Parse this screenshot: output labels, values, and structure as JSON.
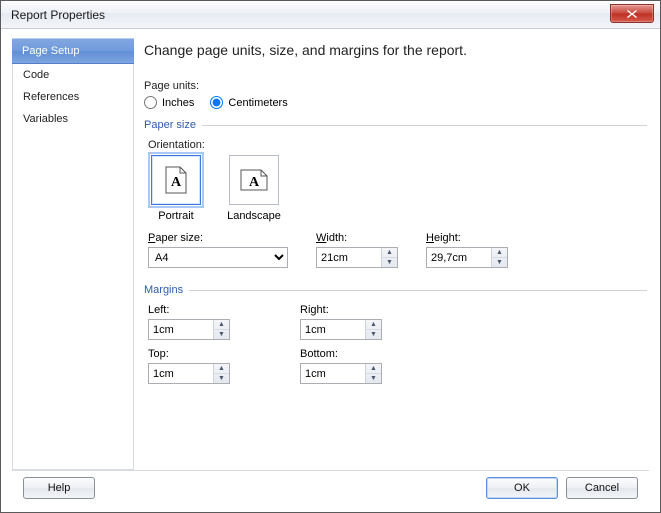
{
  "window": {
    "title": "Report Properties"
  },
  "sidebar": {
    "items": [
      {
        "label": "Page Setup",
        "selected": true
      },
      {
        "label": "Code"
      },
      {
        "label": "References"
      },
      {
        "label": "Variables"
      }
    ]
  },
  "main": {
    "heading": "Change page units, size, and margins for the report.",
    "page_units": {
      "label": "Page units:",
      "options": [
        {
          "label": "Inches",
          "checked": false
        },
        {
          "label": "Centimeters",
          "checked": true
        }
      ]
    },
    "paper_size": {
      "legend": "Paper size",
      "orientation_label": "Orientation:",
      "orientations": [
        {
          "label": "Portrait",
          "selected": true
        },
        {
          "label": "Landscape",
          "selected": false
        }
      ],
      "paper_size_label": "Paper size:",
      "paper_size_value": "A4",
      "width_label": "Width:",
      "width_value": "21cm",
      "height_label": "Height:",
      "height_value": "29,7cm"
    },
    "margins": {
      "legend": "Margins",
      "left_label": "Left:",
      "left_value": "1cm",
      "right_label": "Right:",
      "right_value": "1cm",
      "top_label": "Top:",
      "top_value": "1cm",
      "bottom_label": "Bottom:",
      "bottom_value": "1cm"
    }
  },
  "footer": {
    "help_label": "Help",
    "ok_label": "OK",
    "cancel_label": "Cancel"
  }
}
